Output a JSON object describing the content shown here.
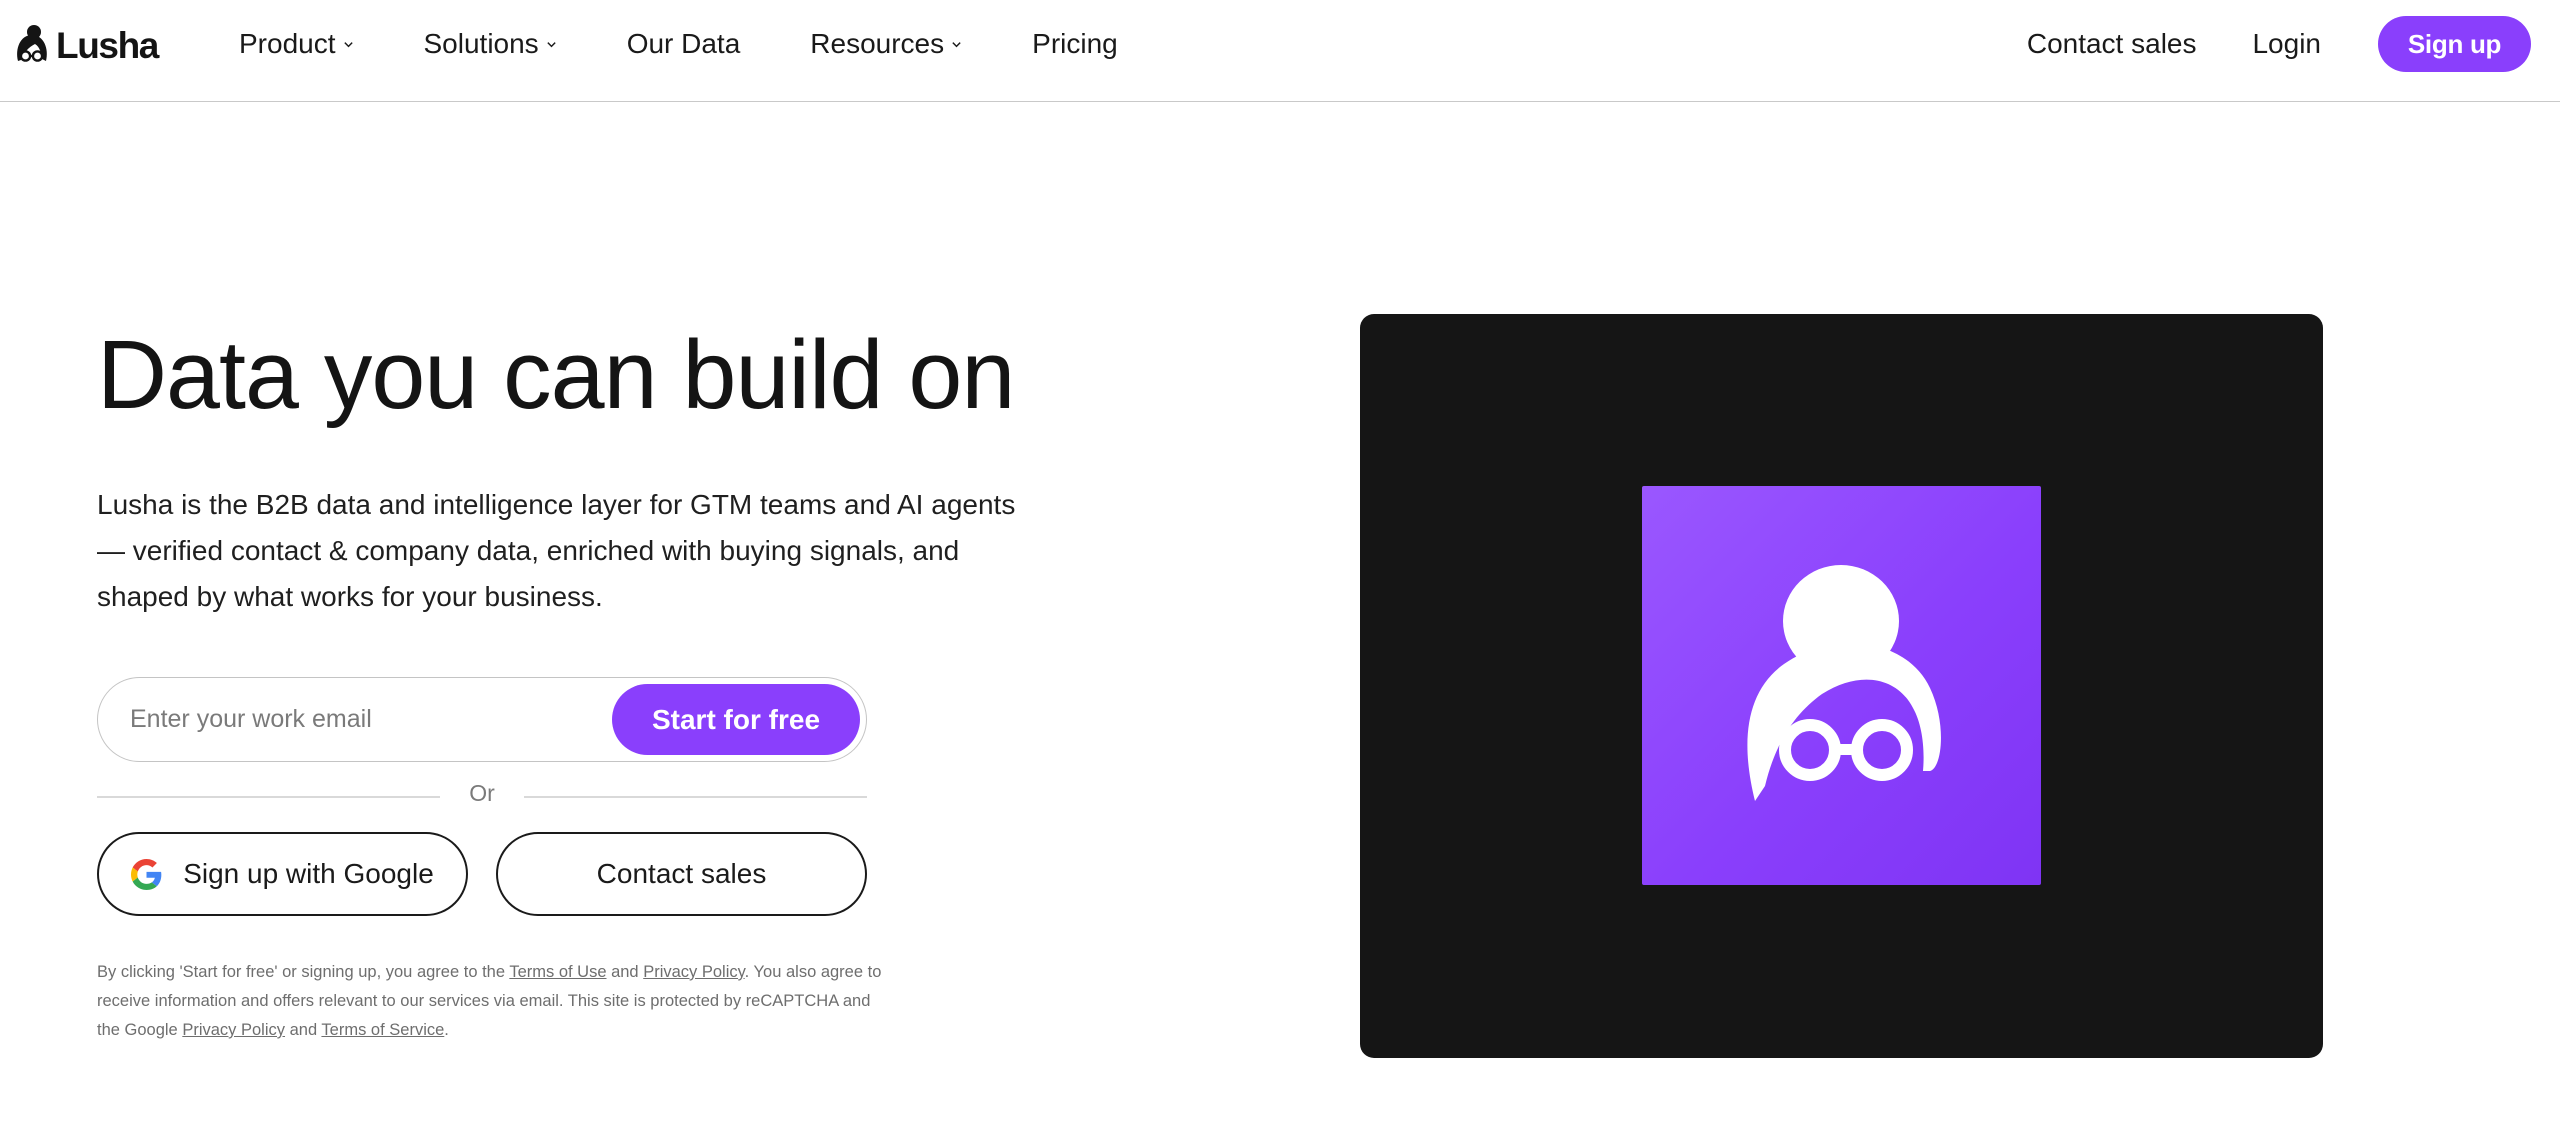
{
  "header": {
    "logo_text": "Lusha",
    "nav": [
      {
        "label": "Product",
        "has_dropdown": true
      },
      {
        "label": "Solutions",
        "has_dropdown": true
      },
      {
        "label": "Our Data",
        "has_dropdown": false
      },
      {
        "label": "Resources",
        "has_dropdown": true
      },
      {
        "label": "Pricing",
        "has_dropdown": false
      }
    ],
    "contact_sales": "Contact sales",
    "login": "Login",
    "signup": "Sign up"
  },
  "hero": {
    "title": "Data you can build on",
    "description": "Lusha is the B2B data and intelligence layer for GTM teams and AI agents — verified contact & company data, enriched with buying signals, and shaped by what works for your business.",
    "email_placeholder": "Enter your work email",
    "email_value": "",
    "start_button": "Start for free",
    "or_text": "Or",
    "google_button": "Sign up with Google",
    "contact_button": "Contact sales",
    "legal": {
      "part1": "By clicking 'Start for free' or signing up, you agree to the ",
      "terms_of_use": "Terms of Use",
      "part2": " and ",
      "privacy_policy": "Privacy Policy",
      "part3": ". You also agree to receive information and offers relevant to our services via email. This site is protected by reCAPTCHA and the Google ",
      "google_privacy_policy": "Privacy Policy",
      "part4": " and ",
      "terms_of_service": "Terms of Service",
      "part5": "."
    }
  },
  "icons": {
    "logo": "lusha-logo-icon",
    "chevron": "chevron-down-icon",
    "google": "google-icon",
    "brand": "lusha-brand-mark-icon"
  },
  "colors": {
    "accent": "#8a3ffc",
    "dark_panel": "#151515",
    "text": "#141414",
    "muted": "#6e6e6e"
  }
}
